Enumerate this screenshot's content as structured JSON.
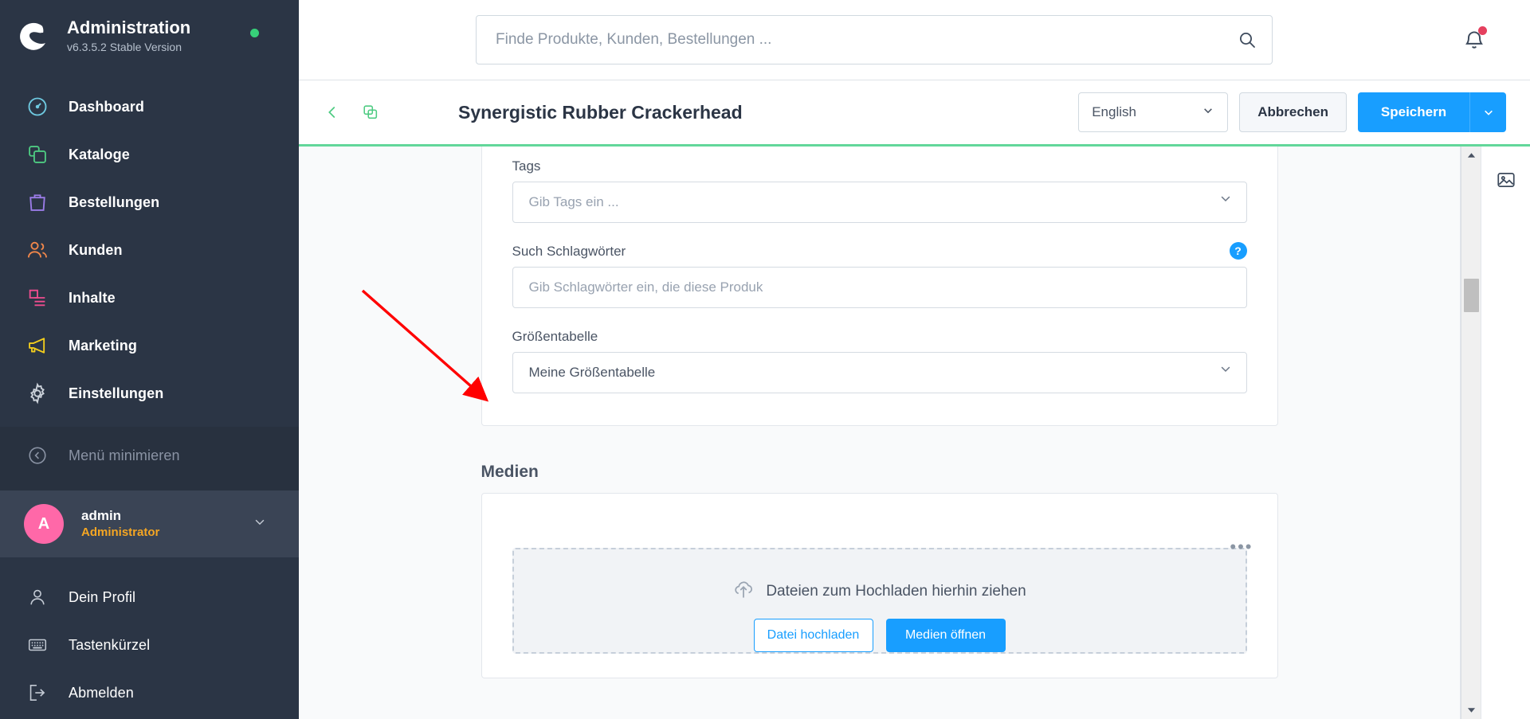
{
  "brand": {
    "title": "Administration",
    "version": "v6.3.5.2 Stable Version",
    "status_color": "#37d079",
    "logo_icon": "shopware-logo-icon"
  },
  "sidebar": {
    "main_items": [
      {
        "label": "Dashboard",
        "icon": "dashboard-icon",
        "color": "#6ec9e0"
      },
      {
        "label": "Kataloge",
        "icon": "catalog-icon",
        "color": "#4ecb82"
      },
      {
        "label": "Bestellungen",
        "icon": "bag-icon",
        "color": "#9b7ce8"
      },
      {
        "label": "Kunden",
        "icon": "users-icon",
        "color": "#f2874a"
      },
      {
        "label": "Inhalte",
        "icon": "content-icon",
        "color": "#ef4d8f"
      },
      {
        "label": "Marketing",
        "icon": "megaphone-icon",
        "color": "#f2cd1d"
      },
      {
        "label": "Einstellungen",
        "icon": "gear-icon",
        "color": "#cdd3db"
      }
    ],
    "minimize": {
      "label": "Menü minimieren",
      "icon": "chevron-left-circle-icon"
    },
    "user": {
      "initial": "A",
      "name": "admin",
      "role": "Administrator",
      "avatar_color": "#ff68a8"
    },
    "bottom_items": [
      {
        "label": "Dein Profil",
        "icon": "person-icon"
      },
      {
        "label": "Tastenkürzel",
        "icon": "keyboard-icon"
      },
      {
        "label": "Abmelden",
        "icon": "logout-icon"
      }
    ]
  },
  "topbar": {
    "search_placeholder": "Finde Produkte, Kunden, Bestellungen ...",
    "search_value": "",
    "search_icon": "search-icon",
    "bell_icon": "bell-icon",
    "bell_badge_color": "#e5405e"
  },
  "header": {
    "back_icon": "chevron-left-icon",
    "duplicate_icon": "duplicate-icon",
    "title": "Synergistic Rubber Crackerhead",
    "language": "English",
    "language_chevron": "chevron-down-icon",
    "cancel_label": "Abbrechen",
    "save_label": "Speichern",
    "save_caret_icon": "chevron-down-icon",
    "primary_color": "#189eff",
    "loadbar_color": "#62d79a"
  },
  "form": {
    "tags": {
      "label": "Tags",
      "value": "",
      "placeholder": "Gib Tags ein ...",
      "chevron_icon": "chevron-down-icon"
    },
    "search_keywords": {
      "label": "Such Schlagwörter",
      "value": "",
      "placeholder": "Gib Schlagwörter ein, die diese Produk",
      "help_icon": "help-circle-icon",
      "help_glyph": "?"
    },
    "size_table": {
      "label": "Größentabelle",
      "value": "Meine Größentabelle",
      "chevron_icon": "chevron-down-icon"
    }
  },
  "media": {
    "section_title": "Medien",
    "context_menu_icon": "ellipsis-icon",
    "context_menu_glyph": "•••",
    "dropzone_icon": "upload-cloud-icon",
    "dropzone_text": "Dateien zum Hochladen hierhin ziehen",
    "button_browse": "Datei hochladen",
    "button_open": "Medien öffnen"
  },
  "right_rail": {
    "media_icon": "image-icon"
  },
  "scrollbar": {
    "up_icon": "triangle-up-icon",
    "down_icon": "triangle-down-icon",
    "thumb": "scroll-thumb"
  },
  "annotation": {
    "arrow_color": "#ff0000",
    "points_to": "Größentabelle"
  }
}
